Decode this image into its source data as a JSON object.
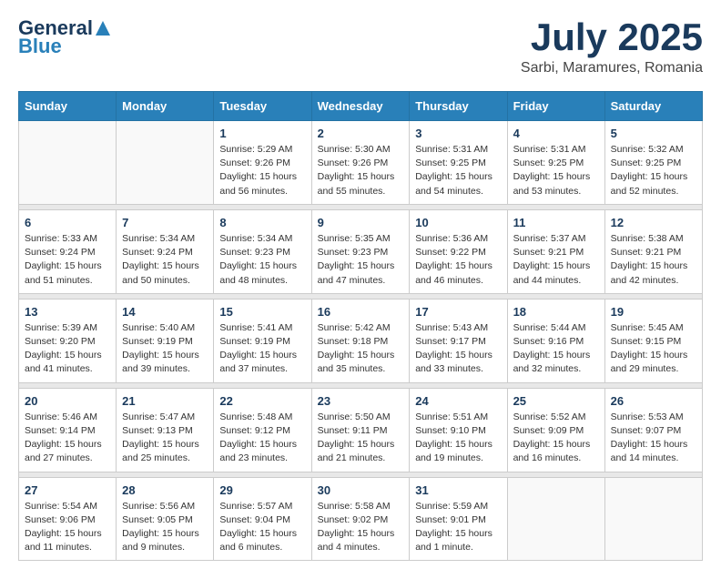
{
  "header": {
    "logo_line1": "General",
    "logo_line2": "Blue",
    "month_title": "July 2025",
    "subtitle": "Sarbi, Maramures, Romania"
  },
  "days_of_week": [
    "Sunday",
    "Monday",
    "Tuesday",
    "Wednesday",
    "Thursday",
    "Friday",
    "Saturday"
  ],
  "weeks": [
    [
      {
        "day": "",
        "empty": true
      },
      {
        "day": "",
        "empty": true
      },
      {
        "day": "1",
        "sunrise": "Sunrise: 5:29 AM",
        "sunset": "Sunset: 9:26 PM",
        "daylight": "Daylight: 15 hours and 56 minutes."
      },
      {
        "day": "2",
        "sunrise": "Sunrise: 5:30 AM",
        "sunset": "Sunset: 9:26 PM",
        "daylight": "Daylight: 15 hours and 55 minutes."
      },
      {
        "day": "3",
        "sunrise": "Sunrise: 5:31 AM",
        "sunset": "Sunset: 9:25 PM",
        "daylight": "Daylight: 15 hours and 54 minutes."
      },
      {
        "day": "4",
        "sunrise": "Sunrise: 5:31 AM",
        "sunset": "Sunset: 9:25 PM",
        "daylight": "Daylight: 15 hours and 53 minutes."
      },
      {
        "day": "5",
        "sunrise": "Sunrise: 5:32 AM",
        "sunset": "Sunset: 9:25 PM",
        "daylight": "Daylight: 15 hours and 52 minutes."
      }
    ],
    [
      {
        "day": "6",
        "sunrise": "Sunrise: 5:33 AM",
        "sunset": "Sunset: 9:24 PM",
        "daylight": "Daylight: 15 hours and 51 minutes."
      },
      {
        "day": "7",
        "sunrise": "Sunrise: 5:34 AM",
        "sunset": "Sunset: 9:24 PM",
        "daylight": "Daylight: 15 hours and 50 minutes."
      },
      {
        "day": "8",
        "sunrise": "Sunrise: 5:34 AM",
        "sunset": "Sunset: 9:23 PM",
        "daylight": "Daylight: 15 hours and 48 minutes."
      },
      {
        "day": "9",
        "sunrise": "Sunrise: 5:35 AM",
        "sunset": "Sunset: 9:23 PM",
        "daylight": "Daylight: 15 hours and 47 minutes."
      },
      {
        "day": "10",
        "sunrise": "Sunrise: 5:36 AM",
        "sunset": "Sunset: 9:22 PM",
        "daylight": "Daylight: 15 hours and 46 minutes."
      },
      {
        "day": "11",
        "sunrise": "Sunrise: 5:37 AM",
        "sunset": "Sunset: 9:21 PM",
        "daylight": "Daylight: 15 hours and 44 minutes."
      },
      {
        "day": "12",
        "sunrise": "Sunrise: 5:38 AM",
        "sunset": "Sunset: 9:21 PM",
        "daylight": "Daylight: 15 hours and 42 minutes."
      }
    ],
    [
      {
        "day": "13",
        "sunrise": "Sunrise: 5:39 AM",
        "sunset": "Sunset: 9:20 PM",
        "daylight": "Daylight: 15 hours and 41 minutes."
      },
      {
        "day": "14",
        "sunrise": "Sunrise: 5:40 AM",
        "sunset": "Sunset: 9:19 PM",
        "daylight": "Daylight: 15 hours and 39 minutes."
      },
      {
        "day": "15",
        "sunrise": "Sunrise: 5:41 AM",
        "sunset": "Sunset: 9:19 PM",
        "daylight": "Daylight: 15 hours and 37 minutes."
      },
      {
        "day": "16",
        "sunrise": "Sunrise: 5:42 AM",
        "sunset": "Sunset: 9:18 PM",
        "daylight": "Daylight: 15 hours and 35 minutes."
      },
      {
        "day": "17",
        "sunrise": "Sunrise: 5:43 AM",
        "sunset": "Sunset: 9:17 PM",
        "daylight": "Daylight: 15 hours and 33 minutes."
      },
      {
        "day": "18",
        "sunrise": "Sunrise: 5:44 AM",
        "sunset": "Sunset: 9:16 PM",
        "daylight": "Daylight: 15 hours and 32 minutes."
      },
      {
        "day": "19",
        "sunrise": "Sunrise: 5:45 AM",
        "sunset": "Sunset: 9:15 PM",
        "daylight": "Daylight: 15 hours and 29 minutes."
      }
    ],
    [
      {
        "day": "20",
        "sunrise": "Sunrise: 5:46 AM",
        "sunset": "Sunset: 9:14 PM",
        "daylight": "Daylight: 15 hours and 27 minutes."
      },
      {
        "day": "21",
        "sunrise": "Sunrise: 5:47 AM",
        "sunset": "Sunset: 9:13 PM",
        "daylight": "Daylight: 15 hours and 25 minutes."
      },
      {
        "day": "22",
        "sunrise": "Sunrise: 5:48 AM",
        "sunset": "Sunset: 9:12 PM",
        "daylight": "Daylight: 15 hours and 23 minutes."
      },
      {
        "day": "23",
        "sunrise": "Sunrise: 5:50 AM",
        "sunset": "Sunset: 9:11 PM",
        "daylight": "Daylight: 15 hours and 21 minutes."
      },
      {
        "day": "24",
        "sunrise": "Sunrise: 5:51 AM",
        "sunset": "Sunset: 9:10 PM",
        "daylight": "Daylight: 15 hours and 19 minutes."
      },
      {
        "day": "25",
        "sunrise": "Sunrise: 5:52 AM",
        "sunset": "Sunset: 9:09 PM",
        "daylight": "Daylight: 15 hours and 16 minutes."
      },
      {
        "day": "26",
        "sunrise": "Sunrise: 5:53 AM",
        "sunset": "Sunset: 9:07 PM",
        "daylight": "Daylight: 15 hours and 14 minutes."
      }
    ],
    [
      {
        "day": "27",
        "sunrise": "Sunrise: 5:54 AM",
        "sunset": "Sunset: 9:06 PM",
        "daylight": "Daylight: 15 hours and 11 minutes."
      },
      {
        "day": "28",
        "sunrise": "Sunrise: 5:56 AM",
        "sunset": "Sunset: 9:05 PM",
        "daylight": "Daylight: 15 hours and 9 minutes."
      },
      {
        "day": "29",
        "sunrise": "Sunrise: 5:57 AM",
        "sunset": "Sunset: 9:04 PM",
        "daylight": "Daylight: 15 hours and 6 minutes."
      },
      {
        "day": "30",
        "sunrise": "Sunrise: 5:58 AM",
        "sunset": "Sunset: 9:02 PM",
        "daylight": "Daylight: 15 hours and 4 minutes."
      },
      {
        "day": "31",
        "sunrise": "Sunrise: 5:59 AM",
        "sunset": "Sunset: 9:01 PM",
        "daylight": "Daylight: 15 hours and 1 minute."
      },
      {
        "day": "",
        "empty": true
      },
      {
        "day": "",
        "empty": true
      }
    ]
  ]
}
